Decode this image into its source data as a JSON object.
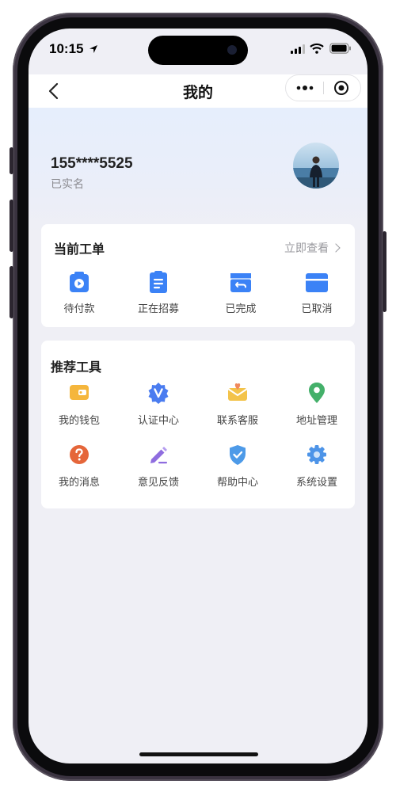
{
  "status_bar": {
    "time": "10:15"
  },
  "navbar": {
    "title": "我的"
  },
  "profile": {
    "phone": "155****5525",
    "verify_status": "已实名"
  },
  "orders": {
    "title": "当前工单",
    "view_all": "立即查看",
    "items": [
      {
        "label": "待付款",
        "icon": "wallet-clock-icon"
      },
      {
        "label": "正在招募",
        "icon": "clipboard-icon"
      },
      {
        "label": "已完成",
        "icon": "box-return-icon"
      },
      {
        "label": "已取消",
        "icon": "card-icon"
      }
    ]
  },
  "tools": {
    "title": "推荐工具",
    "items": [
      {
        "label": "我的钱包",
        "icon": "wallet-icon",
        "color": "#f5b63c"
      },
      {
        "label": "认证中心",
        "icon": "verified-badge-icon",
        "color": "#4a7cf0"
      },
      {
        "label": "联系客服",
        "icon": "mail-heart-icon",
        "color": "#f3c34a"
      },
      {
        "label": "地址管理",
        "icon": "location-pin-icon",
        "color": "#44b06a"
      },
      {
        "label": "我的消息",
        "icon": "question-circle-icon",
        "color": "#e5663a"
      },
      {
        "label": "意见反馈",
        "icon": "pencil-icon",
        "color": "#8f6ddf"
      },
      {
        "label": "帮助中心",
        "icon": "shield-check-icon",
        "color": "#4d9ae8"
      },
      {
        "label": "系统设置",
        "icon": "gear-icon",
        "color": "#4d94e8"
      }
    ]
  },
  "colors": {
    "accent": "#3b82f6",
    "background": "#efeff5"
  }
}
